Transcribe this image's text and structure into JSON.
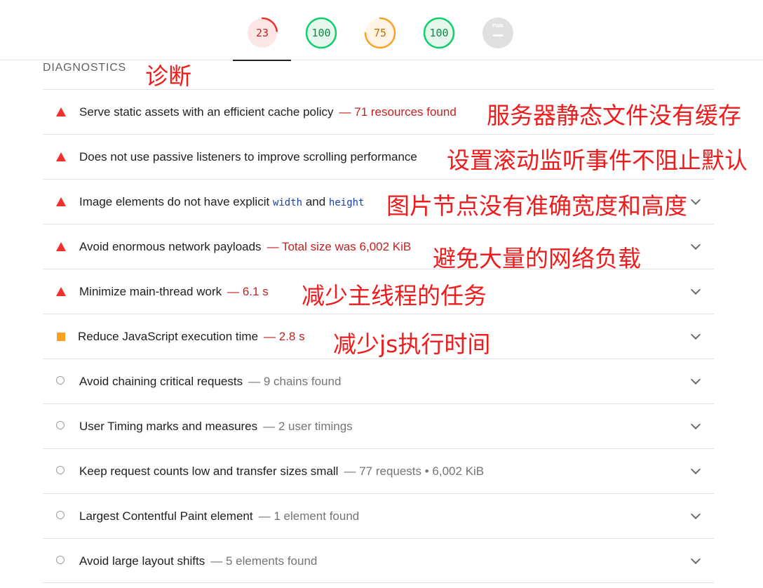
{
  "gauges": [
    {
      "label": "23",
      "value": 23,
      "color": "#f0312d",
      "bg": "#fde7e6"
    },
    {
      "label": "100",
      "value": 100,
      "color": "#0cce6b",
      "bg": "#e6f8ee"
    },
    {
      "label": "75",
      "value": 75,
      "color": "#fba224",
      "bg": "#fff4e5"
    },
    {
      "label": "100",
      "value": 100,
      "color": "#0cce6b",
      "bg": "#e6f8ee"
    },
    {
      "label": "PWA",
      "value": 0,
      "color": "#bdbdbd",
      "bg": "#e0e0e0"
    }
  ],
  "section": {
    "title": "DIAGNOSTICS",
    "annotation": "诊断"
  },
  "audits": [
    {
      "status": "fail",
      "title": "Serve static assets with an efficient cache policy",
      "detail": "— 71 resources found",
      "annotation": "服务器静态文件没有缓存"
    },
    {
      "status": "fail",
      "title": "Does not use passive listeners to improve scrolling performance",
      "detail": "",
      "annotation": "设置滚动监听事件不阻止默认"
    },
    {
      "status": "fail",
      "title_pre": "Image elements do not have explicit ",
      "code1": "width",
      "title_mid": " and ",
      "code2": "height",
      "annotation": "图片节点没有准确宽度和高度"
    },
    {
      "status": "fail",
      "title": "Avoid enormous network payloads",
      "detail": "— Total size was 6,002 KiB",
      "annotation": "避免大量的网络负载"
    },
    {
      "status": "fail",
      "title": "Minimize main-thread work",
      "detail": "— 6.1 s",
      "annotation": "减少主线程的任务"
    },
    {
      "status": "warn",
      "title": "Reduce JavaScript execution time",
      "detail": "— 2.8 s",
      "annotation": "减少js执行时间"
    },
    {
      "status": "info",
      "title": "Avoid chaining critical requests",
      "detail": "— 9 chains found"
    },
    {
      "status": "info",
      "title": "User Timing marks and measures",
      "detail": "— 2 user timings"
    },
    {
      "status": "info",
      "title": "Keep request counts low and transfer sizes small",
      "detail": "— 77 requests • 6,002 KiB"
    },
    {
      "status": "info",
      "title": "Largest Contentful Paint element",
      "detail": "— 1 element found"
    },
    {
      "status": "info",
      "title": "Avoid large layout shifts",
      "detail": "— 5 elements found"
    }
  ]
}
